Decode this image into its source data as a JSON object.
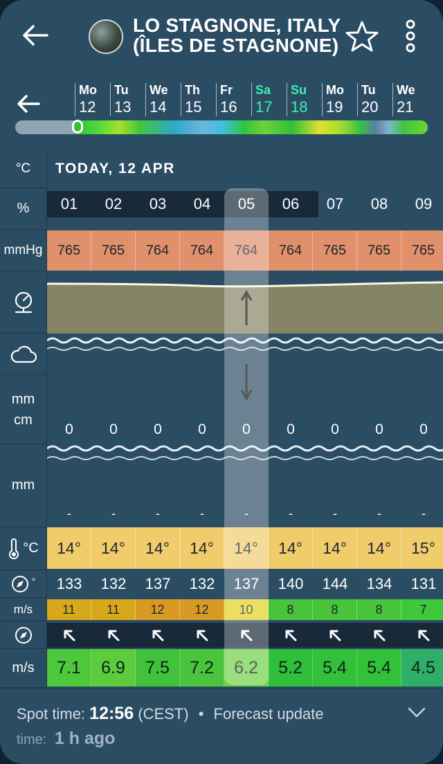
{
  "header": {
    "title_line1": "LO STAGNONE, ITALY",
    "title_line2": "(ÎLES DE STAGNONE)"
  },
  "days": [
    {
      "name": "Mo",
      "date": "12",
      "weekend": false
    },
    {
      "name": "Tu",
      "date": "13",
      "weekend": false
    },
    {
      "name": "We",
      "date": "14",
      "weekend": false
    },
    {
      "name": "Th",
      "date": "15",
      "weekend": false
    },
    {
      "name": "Fr",
      "date": "16",
      "weekend": false
    },
    {
      "name": "Sa",
      "date": "17",
      "weekend": true
    },
    {
      "name": "Su",
      "date": "18",
      "weekend": true
    },
    {
      "name": "Mo",
      "date": "19",
      "weekend": false
    },
    {
      "name": "Tu",
      "date": "20",
      "weekend": false
    },
    {
      "name": "We",
      "date": "21",
      "weekend": false
    }
  ],
  "units": {
    "temp_c": "°C",
    "percent": "%",
    "pressure": "mmHg",
    "snow_line1": "mm",
    "snow_line2": "cm",
    "rain": "mm",
    "air_temp": "°C",
    "direction": "°",
    "gust": "m/s",
    "wind": "m/s"
  },
  "today_label": "TODAY, 12 APR",
  "hours": [
    "01",
    "02",
    "03",
    "04",
    "05",
    "06",
    "07",
    "08",
    "09"
  ],
  "pressure": [
    "765",
    "765",
    "764",
    "764",
    "764",
    "764",
    "765",
    "765",
    "765"
  ],
  "snow": [
    "0",
    "0",
    "0",
    "0",
    "0",
    "0",
    "0",
    "0",
    "0"
  ],
  "rain": [
    "-",
    "-",
    "-",
    "-",
    "-",
    "-",
    "-",
    "-",
    "-"
  ],
  "temperature": [
    "14°",
    "14°",
    "14°",
    "14°",
    "14°",
    "14°",
    "14°",
    "14°",
    "15°"
  ],
  "wind_direction": [
    "133",
    "132",
    "137",
    "132",
    "137",
    "140",
    "144",
    "134",
    "131"
  ],
  "gusts": [
    "11",
    "11",
    "12",
    "12",
    "10",
    "8",
    "8",
    "8",
    "7"
  ],
  "wind_speed": [
    "7.1",
    "6.9",
    "7.5",
    "7.2",
    "6.2",
    "5.2",
    "5.4",
    "5.4",
    "4.5"
  ],
  "colors": {
    "gusts": [
      "#d8a81c",
      "#d8a81c",
      "#d89a22",
      "#d89a22",
      "#e3d21e",
      "#48c43a",
      "#48c43a",
      "#48c43a",
      "#3ec83a"
    ],
    "wind": [
      "#4ec83c",
      "#5dcc3c",
      "#42c23c",
      "#4ac43c",
      "#6fd046",
      "#2fbf3a",
      "#33c13a",
      "#33c13a",
      "#2fae6a"
    ],
    "accent_weekend": "#3df0b4",
    "pressure_row": "#e0906a",
    "temperature_row": "#f0cc6a"
  },
  "footer": {
    "spot_time_label": "Spot time:",
    "spot_time": "12:56",
    "timezone": "(CEST)",
    "separator": "•",
    "update_label": "Forecast update",
    "time_label": "time:",
    "update_value": "1 h ago"
  }
}
